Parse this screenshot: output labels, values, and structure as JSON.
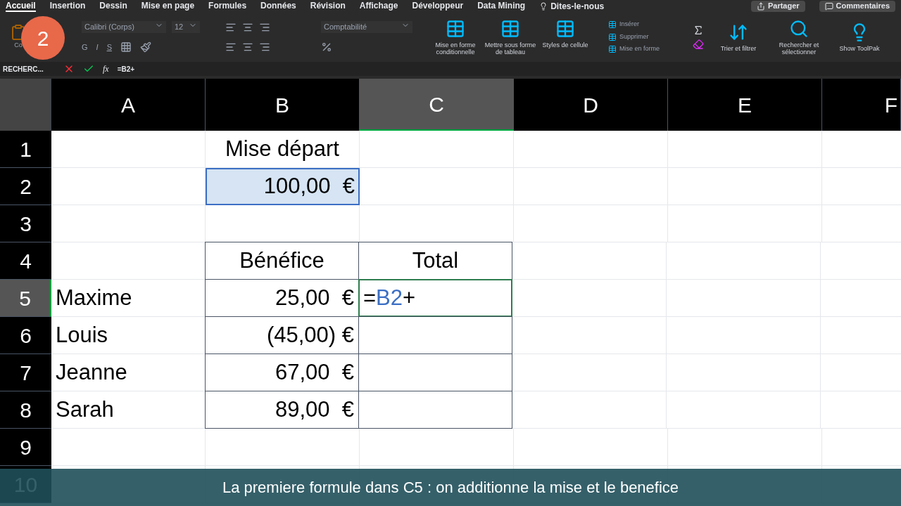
{
  "tabs": [
    {
      "label": "Accueil",
      "selected": true
    },
    {
      "label": "Insertion",
      "selected": false
    },
    {
      "label": "Dessin",
      "selected": false
    },
    {
      "label": "Mise en page",
      "selected": false
    },
    {
      "label": "Formules",
      "selected": false
    },
    {
      "label": "Données",
      "selected": false
    },
    {
      "label": "Révision",
      "selected": false
    },
    {
      "label": "Affichage",
      "selected": false
    },
    {
      "label": "Développeur",
      "selected": false
    },
    {
      "label": "Data Mining",
      "selected": false
    }
  ],
  "tell_me": "Dites-le-nous",
  "top_buttons": [
    "Partager",
    "Commentaires"
  ],
  "ribbon": {
    "paste_label": "Co",
    "font_name": "Calibri (Corps)",
    "font_size": "12",
    "bold": "G",
    "italic": "I",
    "underline": "S",
    "number_format": "Comptabilité",
    "style_buttons": [
      "Mise en forme conditionnelle",
      "Mettre sous forme de tableau",
      "Styles de cellule"
    ],
    "cell_buttons": [
      "Insérer",
      "Supprimer",
      "Mise en forme"
    ],
    "edit_buttons": [
      "Trier et filtrer",
      "Rechercher et sélectionner"
    ],
    "addin_button": "Show ToolPak"
  },
  "step_badge": "2",
  "formula_bar": {
    "name_box": "RECHERC...",
    "fx": "fx",
    "formula": "=B2+"
  },
  "columns": [
    {
      "label": "A",
      "selected": false
    },
    {
      "label": "B",
      "selected": false
    },
    {
      "label": "C",
      "selected": true
    },
    {
      "label": "D",
      "selected": false
    },
    {
      "label": "E",
      "selected": false
    },
    {
      "label": "F",
      "selected": false
    }
  ],
  "rows": [
    {
      "label": "1",
      "selected": false,
      "cells": [
        {
          "kind": "empty"
        },
        {
          "kind": "header",
          "text": "Mise départ"
        },
        {
          "kind": "empty"
        }
      ]
    },
    {
      "label": "2",
      "selected": false,
      "cells": [
        {
          "kind": "empty"
        },
        {
          "kind": "number",
          "text": "100,00  €",
          "highlight": true
        },
        {
          "kind": "empty"
        }
      ]
    },
    {
      "label": "3",
      "selected": false,
      "cells": [
        {
          "kind": "empty"
        },
        {
          "kind": "empty"
        },
        {
          "kind": "empty"
        }
      ]
    },
    {
      "label": "4",
      "selected": false,
      "cells": [
        {
          "kind": "empty"
        },
        {
          "kind": "header",
          "text": "Bénéfice",
          "bordered": true
        },
        {
          "kind": "header",
          "text": "Total",
          "bordered": true
        }
      ]
    },
    {
      "label": "5",
      "selected": true,
      "cells": [
        {
          "kind": "text",
          "text": "Maxime"
        },
        {
          "kind": "number",
          "text": "25,00  €",
          "bordered": true
        },
        {
          "kind": "editing",
          "bordered": true,
          "tokens": [
            {
              "kind": "plain",
              "text": "="
            },
            {
              "kind": "ref",
              "text": "B2"
            },
            {
              "kind": "plain",
              "text": "+"
            }
          ]
        }
      ]
    },
    {
      "label": "6",
      "selected": false,
      "cells": [
        {
          "kind": "text",
          "text": "Louis"
        },
        {
          "kind": "number",
          "text": "(45,00) €",
          "bordered": true
        },
        {
          "kind": "empty",
          "bordered": true
        }
      ]
    },
    {
      "label": "7",
      "selected": false,
      "cells": [
        {
          "kind": "text",
          "text": "Jeanne"
        },
        {
          "kind": "number",
          "text": "67,00  €",
          "bordered": true
        },
        {
          "kind": "empty",
          "bordered": true
        }
      ]
    },
    {
      "label": "8",
      "selected": false,
      "cells": [
        {
          "kind": "text",
          "text": "Sarah"
        },
        {
          "kind": "number",
          "text": "89,00  €",
          "bordered": true
        },
        {
          "kind": "empty",
          "bordered": true
        }
      ]
    },
    {
      "label": "9",
      "selected": false,
      "cells": [
        {
          "kind": "empty"
        },
        {
          "kind": "empty"
        },
        {
          "kind": "empty"
        }
      ]
    },
    {
      "label": "10",
      "selected": false,
      "cells": [
        {
          "kind": "empty"
        },
        {
          "kind": "empty"
        },
        {
          "kind": "empty"
        }
      ]
    }
  ],
  "caption": "La premiere formule dans C5 : on additionne la mise et le benefice"
}
